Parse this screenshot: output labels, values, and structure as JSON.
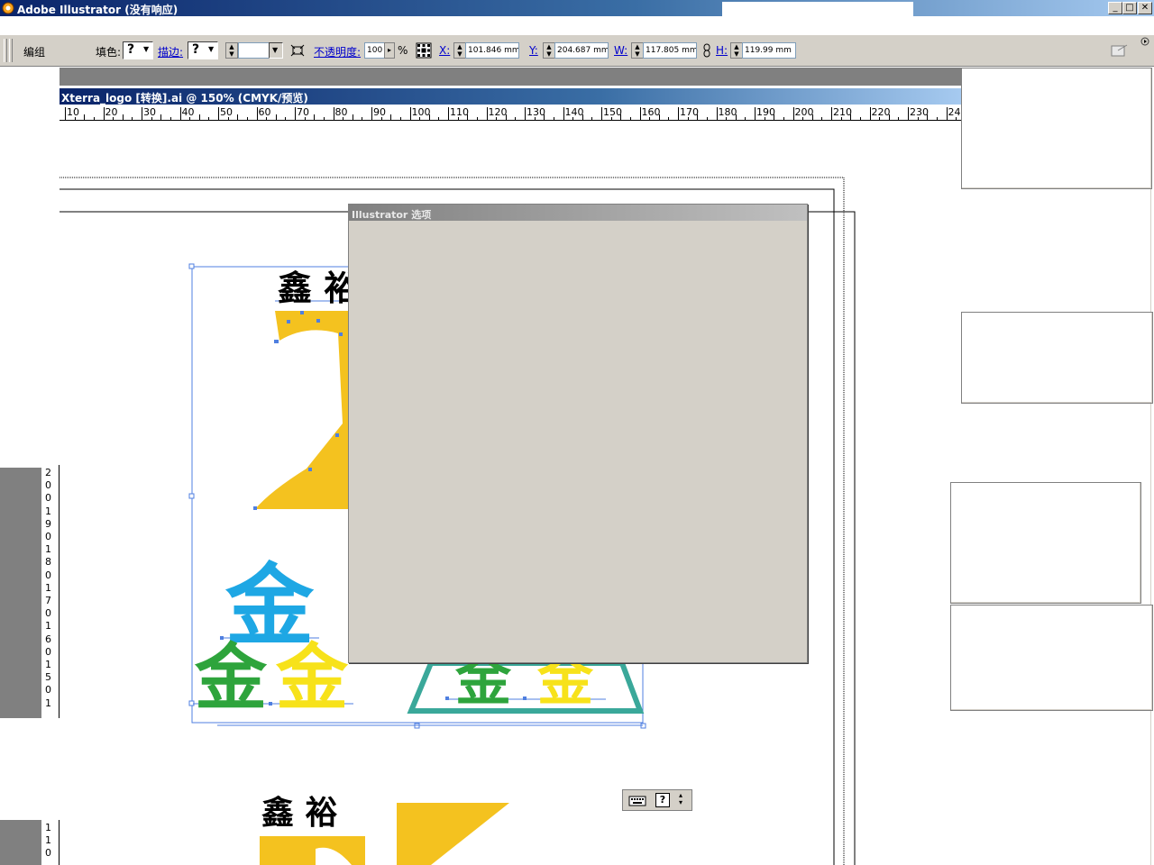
{
  "window": {
    "title": "Adobe Illustrator (没有响应)",
    "minimize": "_",
    "maximize": "□",
    "close": "✕"
  },
  "control_palette": {
    "group_label": "编组",
    "fill_label": "填色:",
    "fill_value": "?",
    "stroke_label": "描边:",
    "stroke_value": "?",
    "opacity_label": "不透明度:",
    "opacity_value": "100",
    "opacity_unit": "%",
    "x_label": "X:",
    "x_value": "101.846 mm",
    "y_label": "Y:",
    "y_value": "204.687 mm",
    "w_label": "W:",
    "w_value": "117.805 mm",
    "h_label": "H:",
    "h_value": "119.99 mm"
  },
  "document": {
    "title": "Xterra_logo [转换].ai @ 150% (CMYK/预览)",
    "ruler_h": [
      "10",
      "20",
      "30",
      "40",
      "50",
      "60",
      "70",
      "80",
      "90",
      "100",
      "110",
      "120",
      "130",
      "140",
      "150",
      "160",
      "170",
      "180",
      "190",
      "200",
      "210",
      "220",
      "230",
      "24"
    ],
    "ruler_v": [
      "2",
      "0",
      "0",
      "1",
      "9",
      "0",
      "1",
      "8",
      "0",
      "1",
      "7",
      "0",
      "1",
      "6",
      "0",
      "1",
      "5",
      "0",
      "1"
    ],
    "ruler_v2": [
      "1",
      "1",
      "0"
    ]
  },
  "artwork": {
    "text_top": "鑫 裕",
    "text_bottom": "鑫 裕",
    "glyph_blue": "金",
    "glyph_green": "金",
    "glyph_yellow": "金",
    "glyph_green2": "金",
    "glyph_yellow2": "金",
    "colors": {
      "yellow": "#f4c21f",
      "blue": "#1ea7e4",
      "green": "#2ea43c",
      "bright_yellow": "#f7e21a",
      "teal": "#3aa89a",
      "selection": "#4f7fe0"
    }
  },
  "dialog": {
    "title": "Illustrator 选项"
  },
  "mini_toolbar": {
    "help": "?"
  }
}
